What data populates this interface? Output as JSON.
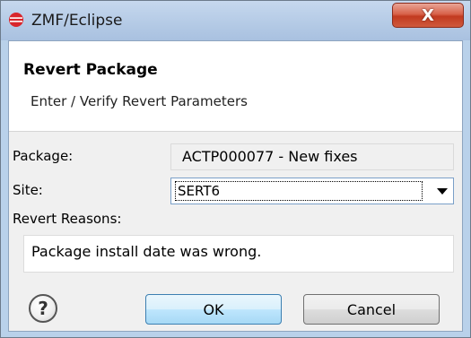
{
  "window": {
    "title": "ZMF/Eclipse",
    "close_label": "X"
  },
  "header": {
    "title": "Revert Package",
    "subtitle": "Enter / Verify Revert Parameters"
  },
  "form": {
    "package_label": "Package:",
    "package_value": "ACTP000077 - New fixes",
    "site_label": "Site:",
    "site_value": "SERT6",
    "reasons_label": "Revert Reasons:",
    "reasons_value": "Package install date was wrong."
  },
  "buttons": {
    "help": "?",
    "ok": "OK",
    "cancel": "Cancel"
  }
}
